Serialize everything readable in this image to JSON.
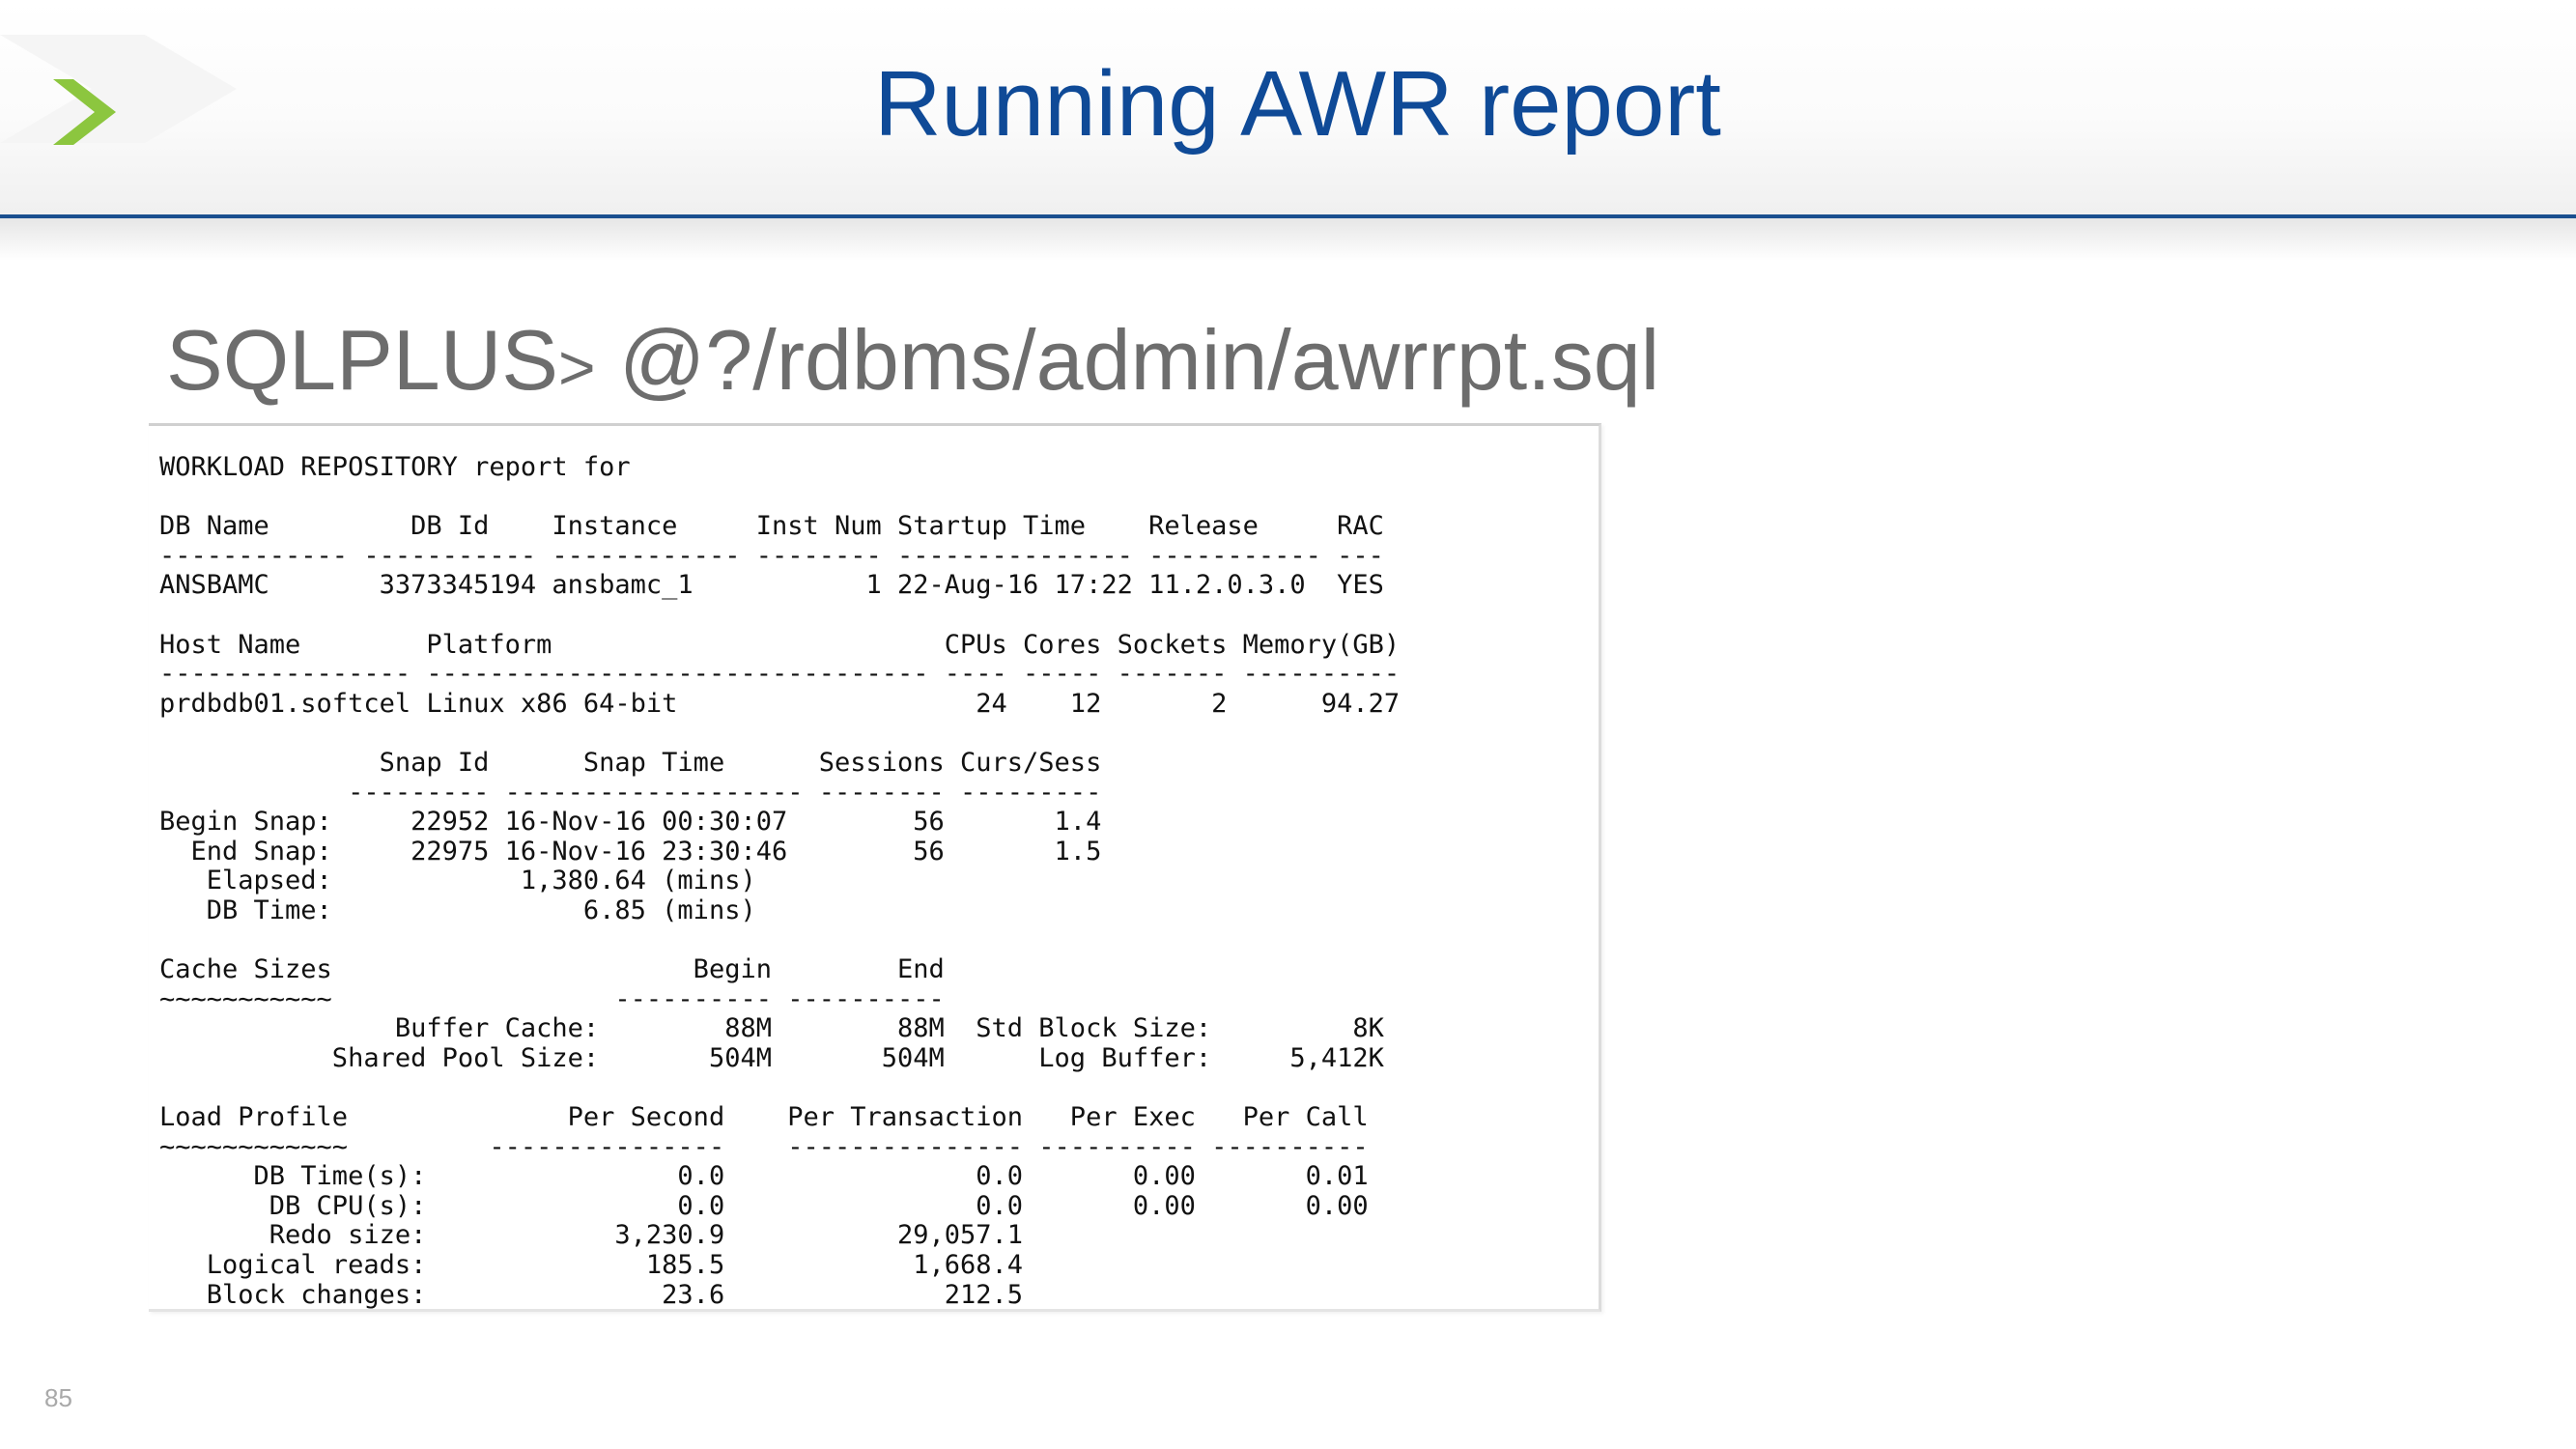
{
  "slide": {
    "title": "Running AWR report",
    "command_prefix": "SQLPLUS",
    "command_prompt": ">",
    "command_text": " @?/rdbms/admin/awrrpt.sql",
    "page_number": "85"
  },
  "brand": {
    "logo_icon": "chevron-right-icon",
    "accent_color": "#8cc63f",
    "title_color": "#0f4a97",
    "rule_color": "#1a4f8f"
  },
  "report": {
    "lines": [
      "WORKLOAD REPOSITORY report for",
      "",
      "DB Name         DB Id    Instance     Inst Num Startup Time    Release     RAC",
      "------------ ----------- ------------ -------- --------------- ----------- ---",
      "ANSBAMC       3373345194 ansbamc_1           1 22-Aug-16 17:22 11.2.0.3.0  YES",
      "",
      "Host Name        Platform                         CPUs Cores Sockets Memory(GB)",
      "---------------- -------------------------------- ---- ----- ------- ----------",
      "prdbdb01.softcel Linux x86 64-bit                   24    12       2      94.27",
      "",
      "              Snap Id      Snap Time      Sessions Curs/Sess",
      "            --------- ------------------- -------- ---------",
      "Begin Snap:     22952 16-Nov-16 00:30:07        56       1.4",
      "  End Snap:     22975 16-Nov-16 23:30:46        56       1.5",
      "   Elapsed:            1,380.64 (mins)",
      "   DB Time:                6.85 (mins)",
      "",
      "Cache Sizes                       Begin        End",
      "~~~~~~~~~~~                  ---------- ----------",
      "               Buffer Cache:        88M        88M  Std Block Size:         8K",
      "           Shared Pool Size:       504M       504M      Log Buffer:     5,412K",
      "",
      "Load Profile              Per Second    Per Transaction   Per Exec   Per Call",
      "~~~~~~~~~~~~         ---------------    --------------- ---------- ----------",
      "      DB Time(s):                0.0                0.0       0.00       0.01",
      "       DB CPU(s):                0.0                0.0       0.00       0.00",
      "       Redo size:            3,230.9           29,057.1",
      "   Logical reads:              185.5            1,668.4",
      "   Block changes:               23.6              212.5"
    ]
  }
}
